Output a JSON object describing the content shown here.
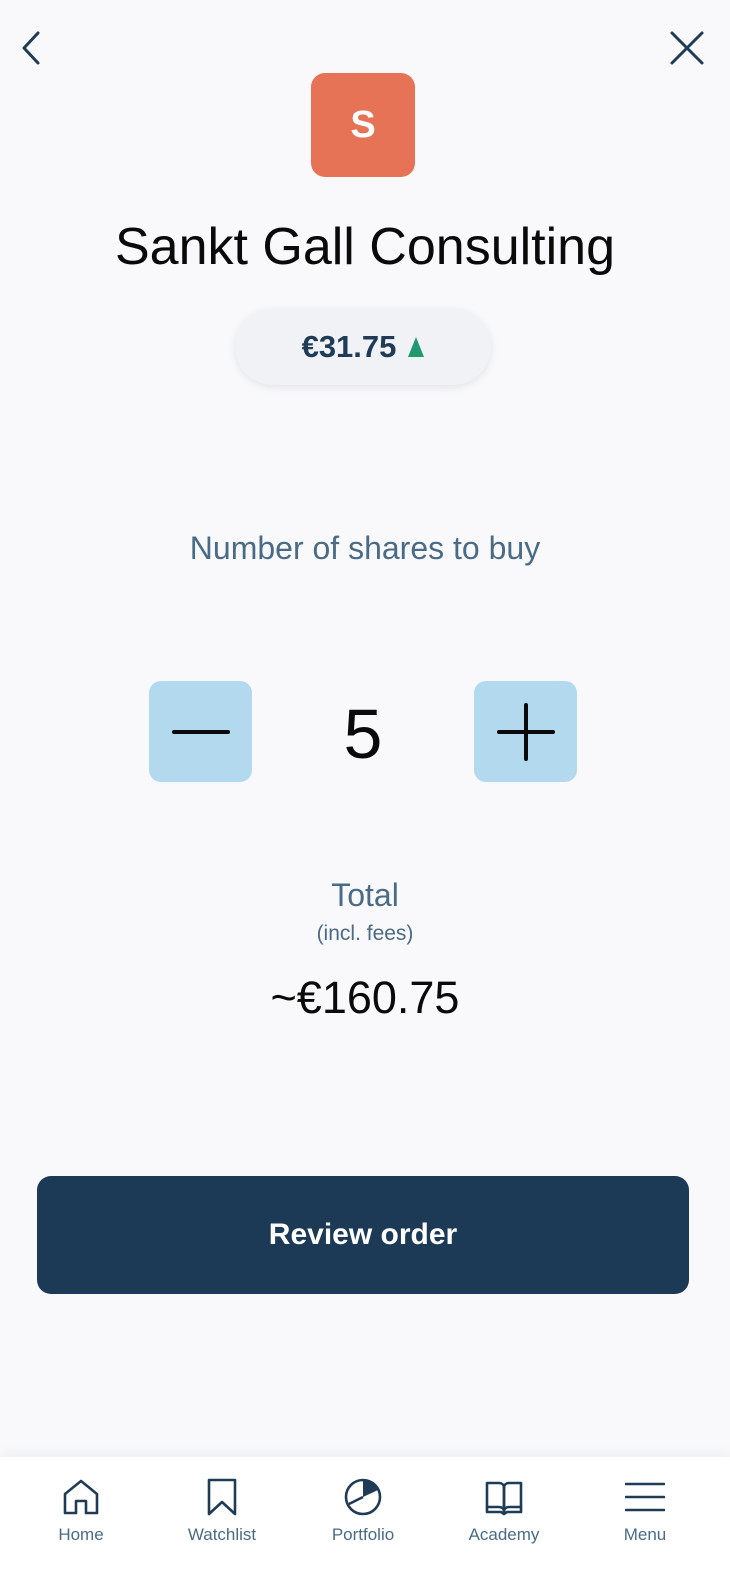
{
  "header": {
    "back_icon": "chevron-left-icon",
    "close_icon": "close-icon"
  },
  "company": {
    "logo_letter": "S",
    "logo_color": "#e67355",
    "name": "Sankt Gall Consulting",
    "price": "€31.75",
    "trend": "up",
    "trend_color": "#1f9a6f"
  },
  "order": {
    "shares_label": "Number of shares to buy",
    "quantity": "5",
    "minus_icon": "minus-icon",
    "plus_icon": "plus-icon",
    "total_label": "Total",
    "fees_note": "(incl. fees)",
    "total_value": "~€160.75"
  },
  "actions": {
    "review_label": "Review order",
    "button_color": "#1c3a55"
  },
  "nav": {
    "items": [
      {
        "label": "Home",
        "icon": "home-icon"
      },
      {
        "label": "Watchlist",
        "icon": "bookmark-icon"
      },
      {
        "label": "Portfolio",
        "icon": "pie-chart-icon"
      },
      {
        "label": "Academy",
        "icon": "book-icon"
      },
      {
        "label": "Menu",
        "icon": "hamburger-menu-icon"
      }
    ]
  }
}
